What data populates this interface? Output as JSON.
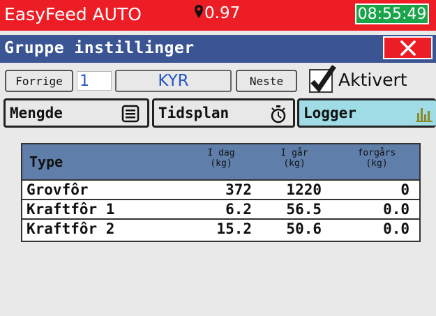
{
  "status_bar": {
    "app_title": "EasyFeed AUTO",
    "signal_value": "0.97",
    "clock": "08:55:49",
    "location_icon": "map-pin-icon"
  },
  "window": {
    "title": "Gruppe instillinger",
    "close_label": "X"
  },
  "group_nav": {
    "prev_label": "Forrige",
    "group_number": "1",
    "group_name": "KYR",
    "next_label": "Neste",
    "active_label": "Aktivert",
    "active_checked": true
  },
  "tabs": [
    {
      "label": "Mengde",
      "icon": "list-icon",
      "selected": false
    },
    {
      "label": "Tidsplan",
      "icon": "stopwatch-icon",
      "selected": false
    },
    {
      "label": "Logger",
      "icon": "bar-chart-icon",
      "selected": true
    }
  ],
  "table": {
    "headers": {
      "type": "Type",
      "today": [
        "I dag",
        "(kg)"
      ],
      "yesterday": [
        "I går",
        "(kg)"
      ],
      "before": [
        "forgårs",
        "(kg)"
      ]
    },
    "rows": [
      {
        "type": "Grovfôr",
        "today": "372",
        "yesterday": "1220",
        "before": "0"
      },
      {
        "type": "Kraftfôr 1",
        "today": "6.2",
        "yesterday": "56.5",
        "before": "0.0"
      },
      {
        "type": "Kraftfôr 2",
        "today": "15.2",
        "yesterday": "50.6",
        "before": "0.0"
      }
    ]
  },
  "colors": {
    "status_bar": "#ec1d25",
    "title_bar": "#3a5494",
    "clock_bg": "#1aa44a",
    "selected_tab": "#9fdce6",
    "table_header": "#5f7faa"
  }
}
